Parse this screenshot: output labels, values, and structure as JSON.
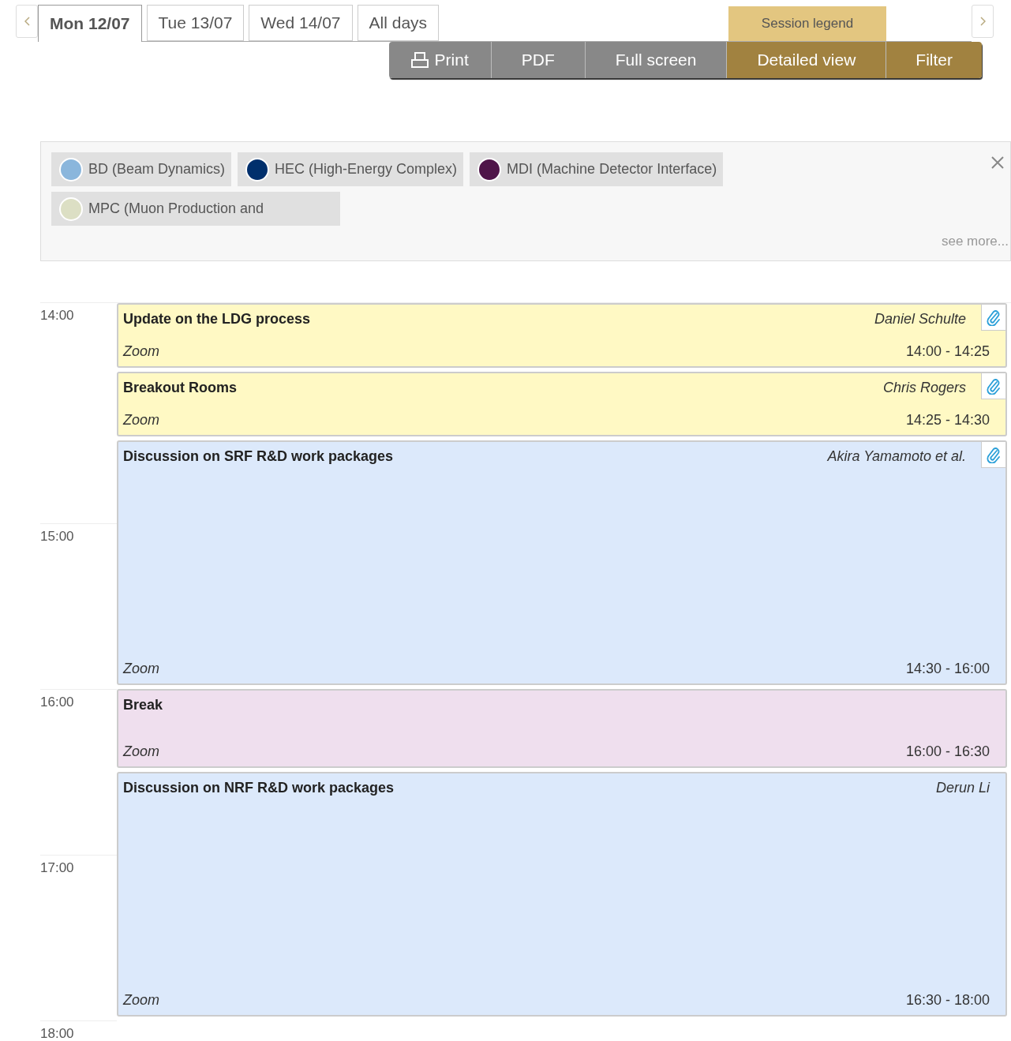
{
  "day_tabs": [
    {
      "label": "Mon 12/07",
      "selected": true
    },
    {
      "label": "Tue 13/07",
      "selected": false
    },
    {
      "label": "Wed 14/07",
      "selected": false
    },
    {
      "label": "All days",
      "selected": false
    }
  ],
  "legend_tab": "Session legend",
  "toolbar": [
    {
      "label": "Print",
      "kind": "print",
      "active": false
    },
    {
      "label": "PDF",
      "kind": "plain",
      "active": false
    },
    {
      "label": "Full screen",
      "kind": "plain",
      "active": false
    },
    {
      "label": "Detailed view",
      "kind": "plain",
      "active": true
    },
    {
      "label": "Filter",
      "kind": "plain",
      "active": true
    }
  ],
  "legend": {
    "items": [
      {
        "label": "BD (Beam Dynamics)",
        "color": "#8ab6dc"
      },
      {
        "label": "HEC (High-Energy Complex)",
        "color": "#002f6c"
      },
      {
        "label": "MDI (Machine Detector Interface)",
        "color": "#4f1549"
      },
      {
        "label": "MPC (Muon Production and",
        "color": "#dcdfc4"
      }
    ],
    "see_more": "see more..."
  },
  "hours": [
    "14:00",
    "15:00",
    "16:00",
    "17:00",
    "18:00"
  ],
  "entries": [
    {
      "title": "Update on the LDG process",
      "speaker": "Daniel Schulte",
      "location": "Zoom",
      "time": "14:00 - 14:25",
      "color": "#fff9c4",
      "attachment": true
    },
    {
      "title": "Breakout Rooms",
      "speaker": "Chris Rogers",
      "location": "Zoom",
      "time": "14:25 - 14:30",
      "color": "#fff9c4",
      "attachment": true
    },
    {
      "title": "Discussion on SRF R&D work packages",
      "speaker": "Akira Yamamoto et al.",
      "location": "Zoom",
      "time": "14:30 - 16:00",
      "color": "#dce9fb",
      "attachment": true
    },
    {
      "title": "Break",
      "location": "Zoom",
      "time": "16:00 - 16:30",
      "color": "#efdfee",
      "attachment": false
    },
    {
      "title": "Discussion on NRF R&D work packages",
      "speaker": "Derun Li",
      "location": "Zoom",
      "time": "16:30 - 18:00",
      "color": "#dce9fb",
      "attachment": false
    }
  ]
}
